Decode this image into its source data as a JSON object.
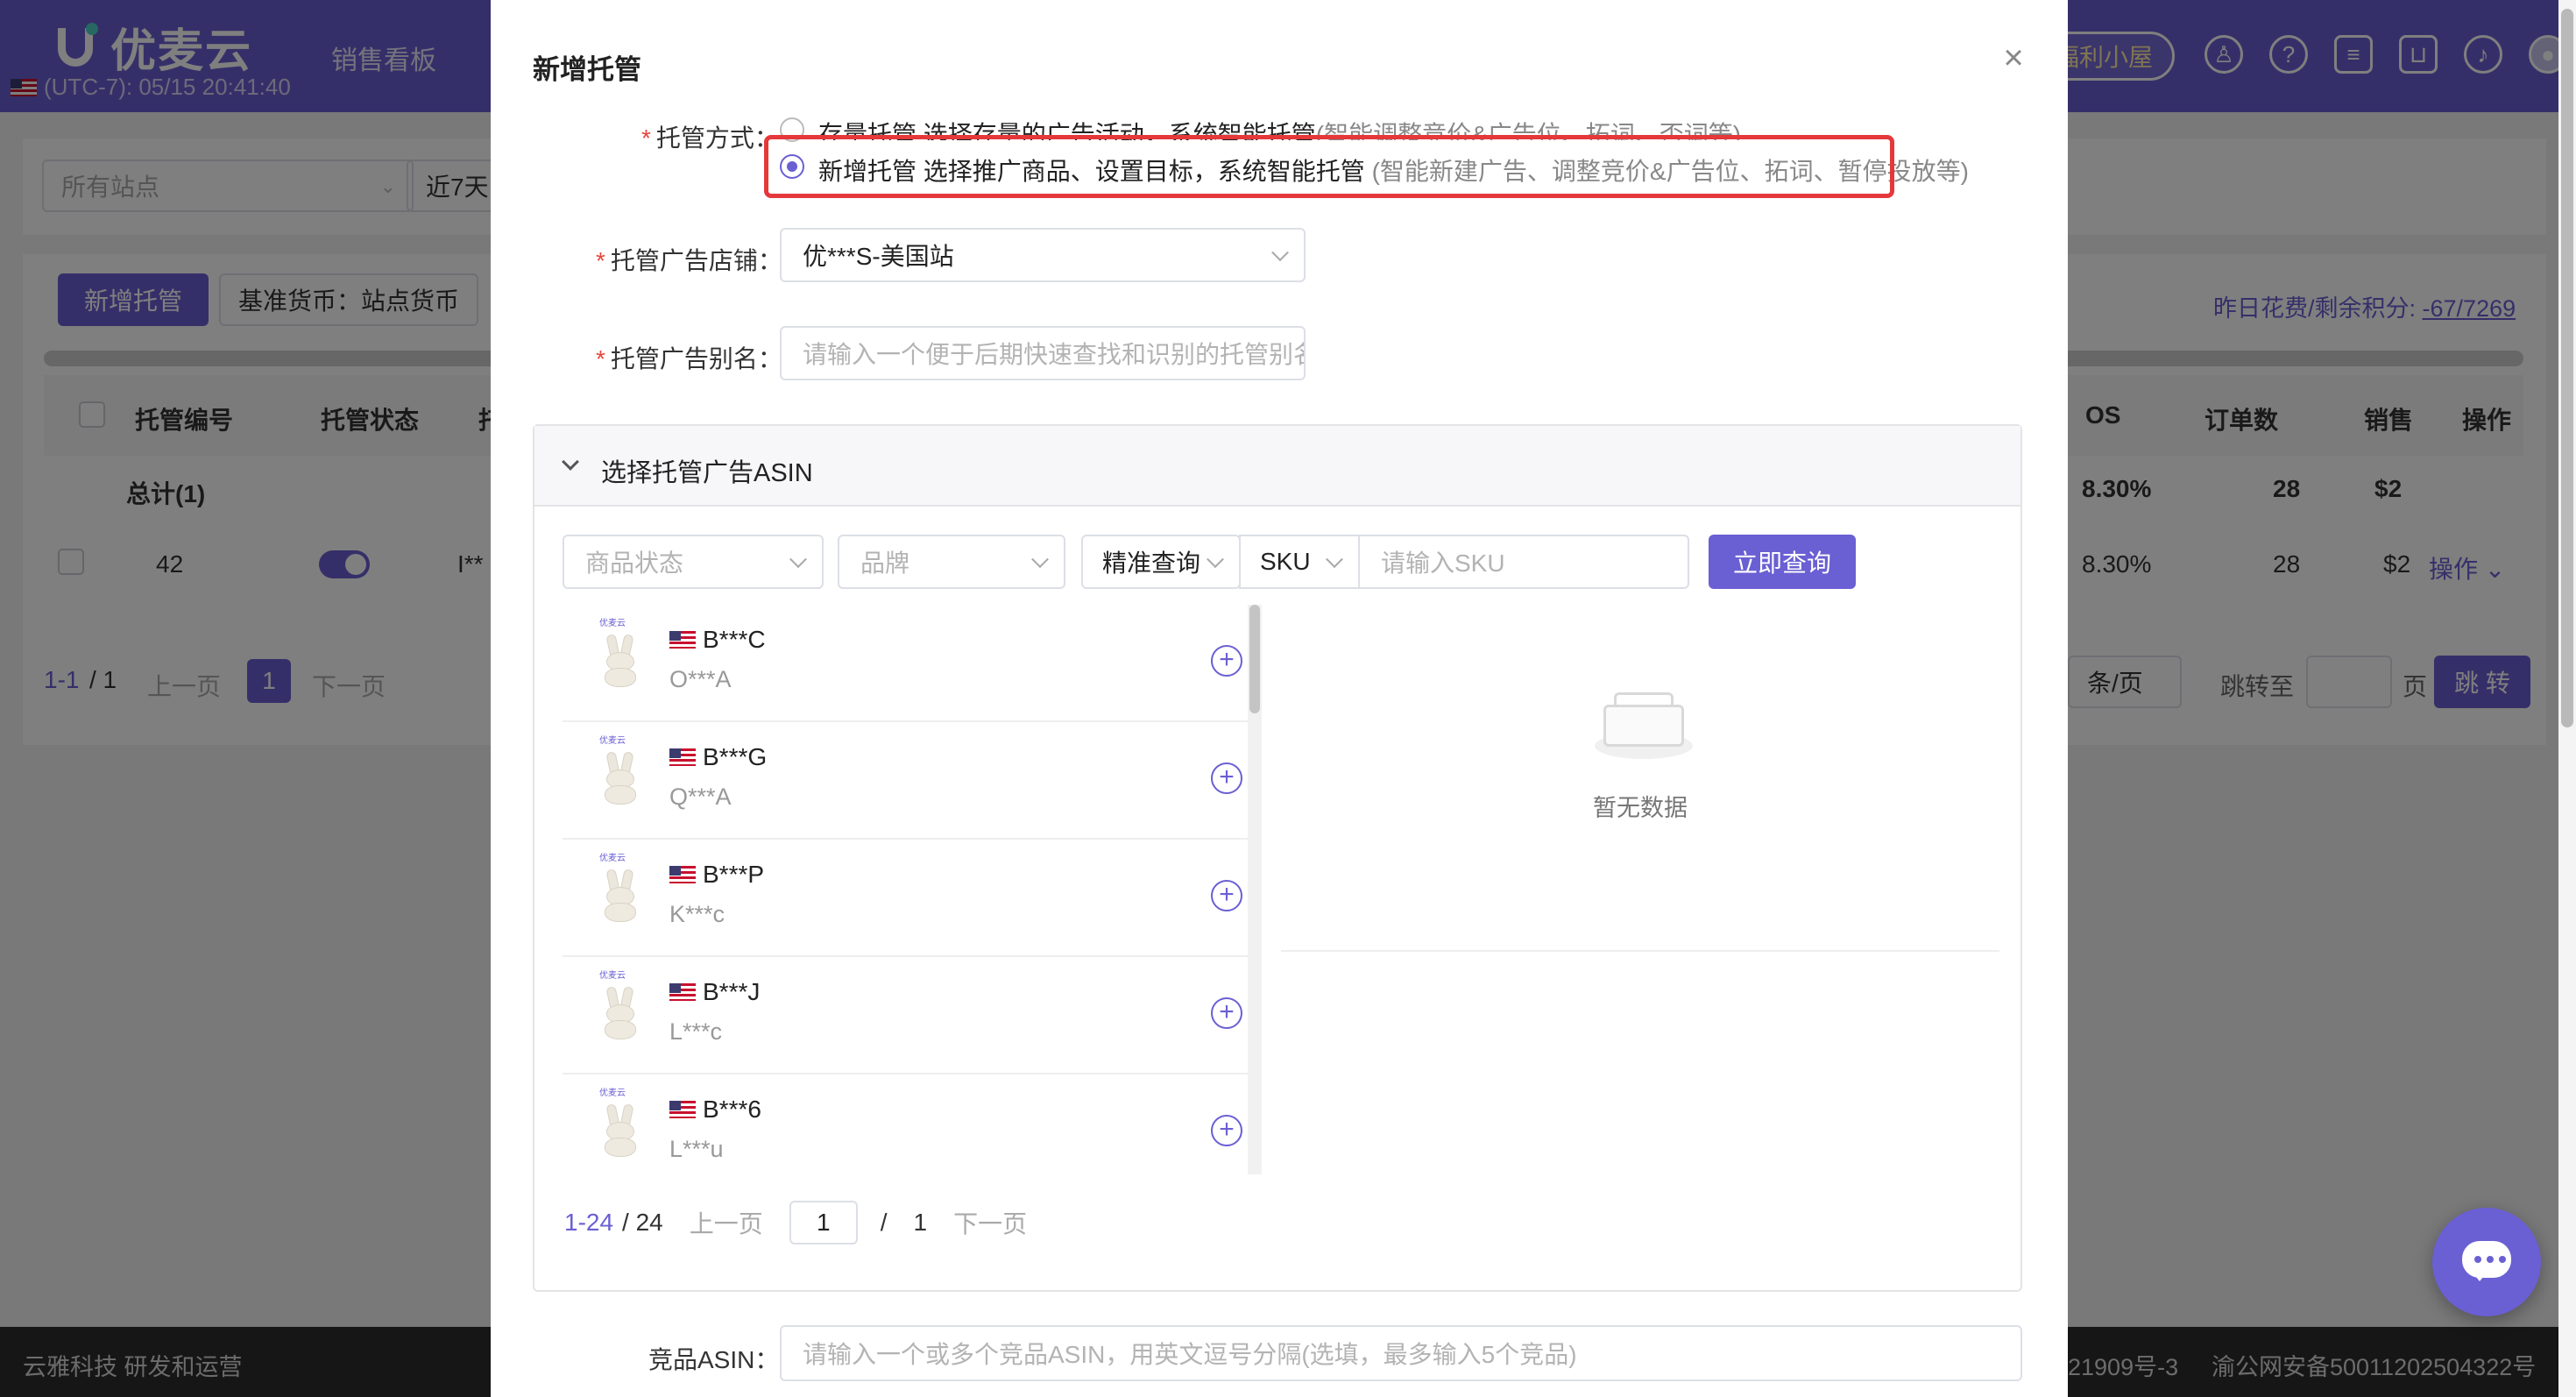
{
  "app": {
    "logo_text": "优麦云",
    "clock": "(UTC-7): 05/15 20:41:40",
    "nav_item": "销售看板",
    "welfare_label": "福利小屋",
    "site_placeholder": "所有站点",
    "date_range": "近7天",
    "new_btn": "新增托管",
    "currency_btn": "基准货币：站点货币",
    "spend_label": "昨日花费/剩余积分:",
    "spend_value": "-67/7269",
    "headers": {
      "id": "托管编号",
      "status": "托管状态",
      "type": "托管",
      "acos": "OS",
      "orders": "订单数",
      "sales": "销售",
      "action": "操作"
    },
    "total_row": {
      "label": "总计(1)",
      "acos": "8.30%",
      "orders": "28",
      "sales": "$2"
    },
    "row": {
      "id": "42",
      "name": "I**",
      "acos": "8.30%",
      "orders": "28",
      "sales": "$2",
      "action": "操作"
    },
    "pager": {
      "range": "1-1",
      "total": "/ 1",
      "prev": "上一页",
      "page": "1",
      "next": "下一页",
      "per_page": "条/页",
      "jump_to": "跳转至",
      "page_unit": "页",
      "jump_btn": "跳 转"
    },
    "footer_left": "云雅科技 研发和运营",
    "footer_right_1": "21909号-3",
    "footer_right_2": "渝公网安备50011202504322号"
  },
  "modal": {
    "title": "新增托管",
    "mode_label": "托管方式：",
    "option1": {
      "main": "存量托管 选择存量的广告活动，系统智能托管",
      "sub": "(智能调整竞价&广告位、拓词、否词等)"
    },
    "option2": {
      "main": "新增托管 选择推广商品、设置目标，系统智能托管",
      "sub": " (智能新建广告、调整竞价&广告位、拓词、暂停投放等)"
    },
    "store_label": "托管广告店铺：",
    "store_value": "优***S-美国站",
    "alias_label": "托管广告别名：",
    "alias_placeholder": "请输入一个便于后期快速查找和识别的托管别名",
    "asin_section_title": "选择托管广告ASIN",
    "filters": {
      "status_placeholder": "商品状态",
      "brand_placeholder": "品牌",
      "match_mode": "精准查询",
      "field": "SKU",
      "sku_placeholder": "请输入SKU",
      "query_btn": "立即查询"
    },
    "products": [
      {
        "asin": "B***C",
        "sku": "O***A",
        "brand_mark": "优麦云"
      },
      {
        "asin": "B***G",
        "sku": "Q***A",
        "brand_mark": "优麦云"
      },
      {
        "asin": "B***P",
        "sku": "K***c",
        "brand_mark": "优麦云"
      },
      {
        "asin": "B***J",
        "sku": "L***c",
        "brand_mark": "优麦云"
      },
      {
        "asin": "B***6",
        "sku": "L***u",
        "brand_mark": "优麦云"
      }
    ],
    "empty_text": "暂无数据",
    "pager": {
      "range": "1-24",
      "total": "/ 24",
      "prev": "上一页",
      "page": "1",
      "sep": "/",
      "pages": "1",
      "next": "下一页"
    },
    "competitor_label": "竞品ASIN：",
    "competitor_placeholder": "请输入一个或多个竞品ASIN，用英文逗号分隔(选填，最多输入5个竞品)"
  },
  "colors": {
    "accent": "#6a5fd3",
    "highlight": "#e5383b"
  },
  "icons": [
    "close-icon",
    "chevron-down-icon",
    "plus-circle-icon",
    "empty-box-icon",
    "chat-icon",
    "user-icon",
    "help-icon",
    "message-icon",
    "cart-icon",
    "bell-icon"
  ]
}
